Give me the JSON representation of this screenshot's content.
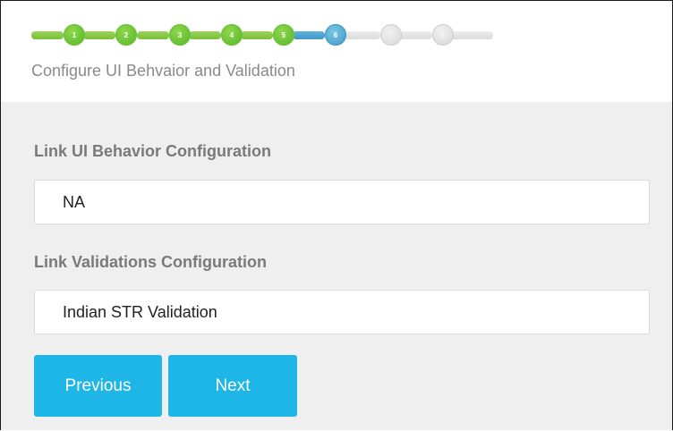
{
  "wizard": {
    "steps": [
      {
        "label": "1",
        "state": "done"
      },
      {
        "label": "2",
        "state": "done"
      },
      {
        "label": "3",
        "state": "done"
      },
      {
        "label": "4",
        "state": "done"
      },
      {
        "label": "5",
        "state": "done"
      },
      {
        "label": "6",
        "state": "current"
      },
      {
        "label": "7",
        "state": "todo"
      },
      {
        "label": "8",
        "state": "todo"
      }
    ],
    "subtitle": "Configure UI Behvaior and Validation"
  },
  "form": {
    "ui_behavior": {
      "label": "Link UI Behavior Configuration",
      "value": "NA"
    },
    "validations": {
      "label": "Link Validations Configuration",
      "value": "Indian STR Validation"
    }
  },
  "buttons": {
    "previous": "Previous",
    "next": "Next"
  },
  "colors": {
    "done": "#6cc33a",
    "current": "#3f98c6",
    "todo": "#d6d6d6",
    "button": "#1eb6e6"
  }
}
